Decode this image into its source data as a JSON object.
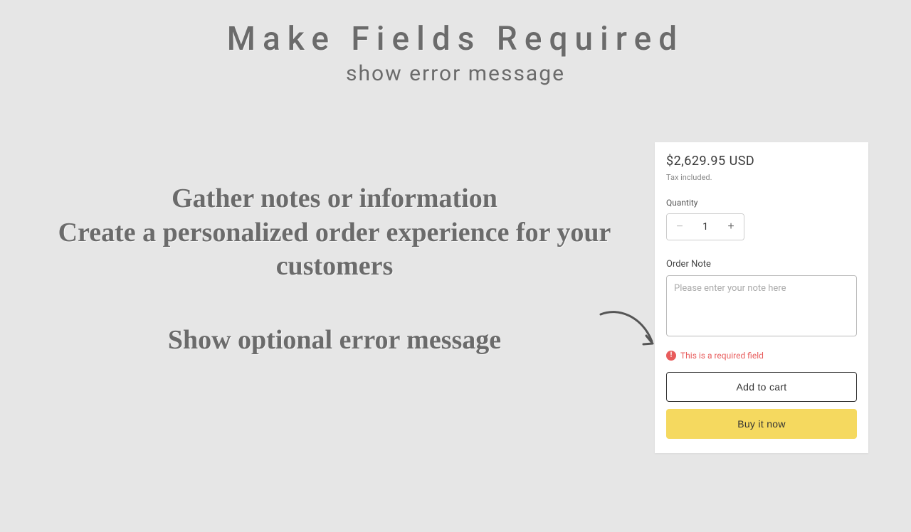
{
  "heading": {
    "title": "Make Fields Required",
    "subtitle": "show error message"
  },
  "marketing": {
    "line1": "Gather notes or information",
    "line2": "Create a personalized order experience for your customers",
    "line3": "Show optional error message"
  },
  "card": {
    "price": "$2,629.95 USD",
    "tax_note": "Tax included.",
    "quantity_label": "Quantity",
    "quantity_value": "1",
    "note_label": "Order Note",
    "note_placeholder": "Please enter your note here",
    "error_text": "This is a required field",
    "add_to_cart_label": "Add to cart",
    "buy_now_label": "Buy it now"
  }
}
